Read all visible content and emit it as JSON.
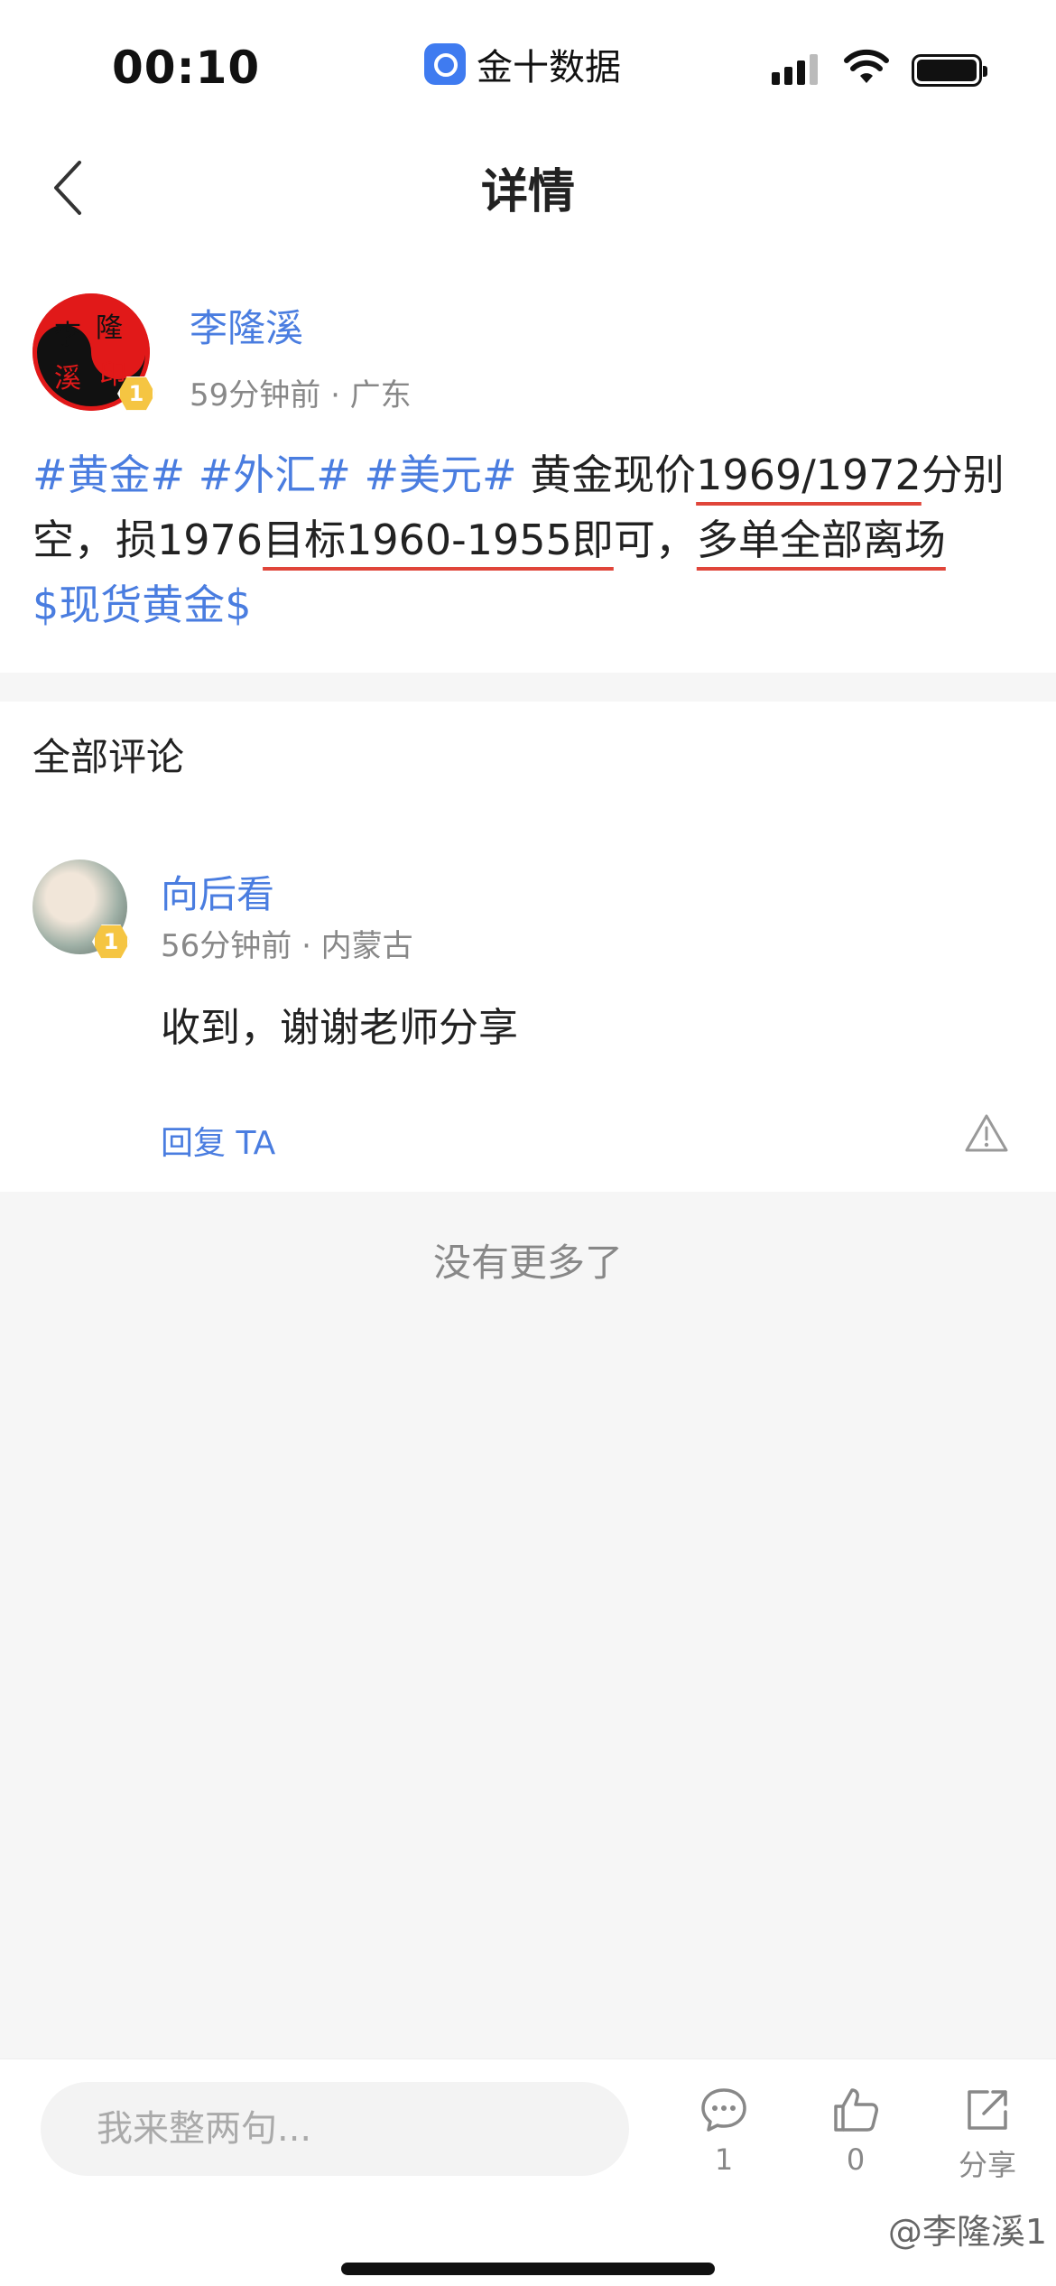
{
  "status_bar": {
    "time": "00:10",
    "back_app": "金十数据"
  },
  "nav": {
    "title": "详情"
  },
  "post": {
    "author": "李隆溪",
    "avatar_text": [
      "李",
      "隆",
      "溪",
      "印"
    ],
    "level": "1",
    "meta": "59分钟前 · 广东",
    "tags": [
      "#黄金#",
      "#外汇#",
      "#美元#"
    ],
    "text_1": "黄金现价",
    "price": "1969/1972",
    "text_2": "分别空，损1976",
    "target": "目标1960-1955即",
    "text_3": "可，",
    "exit": "多单全部离场",
    "stock_tag": "$现货黄金$"
  },
  "comments": {
    "heading": "全部评论",
    "items": [
      {
        "user": "向后看",
        "level": "1",
        "meta": "56分钟前 · 内蒙古",
        "text": "收到，谢谢老师分享",
        "reply_label": "回复 TA"
      }
    ],
    "end_text": "没有更多了"
  },
  "bottom_bar": {
    "input_placeholder": "我来整两句...",
    "comment_count": "1",
    "like_count": "0",
    "share_label": "分享",
    "watermark": "@李隆溪1"
  }
}
